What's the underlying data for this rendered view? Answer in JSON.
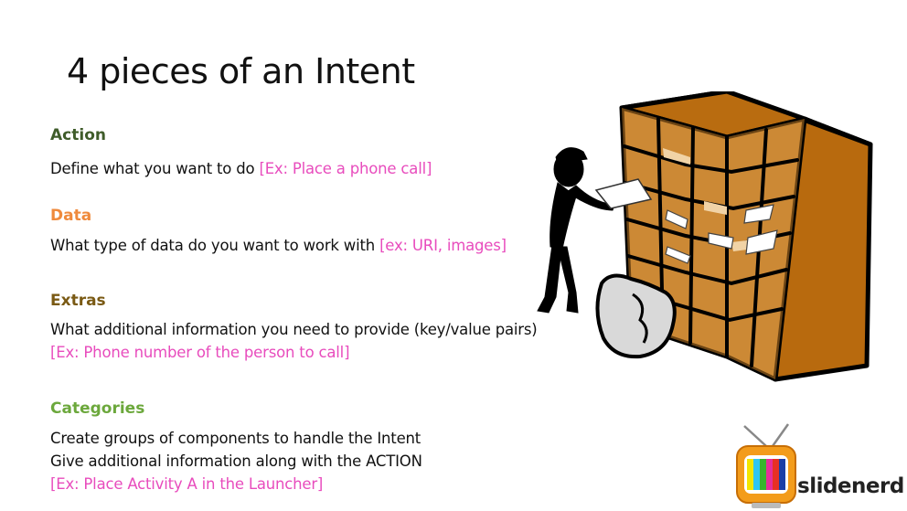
{
  "slide": {
    "title": "4 pieces of an Intent",
    "colors": {
      "action_heading": "#3f5c2a",
      "data_heading": "#ef8a3c",
      "extras_heading": "#7a5a14",
      "categories_heading": "#6ca83c",
      "example_text": "#e84cbd"
    },
    "sections": {
      "action": {
        "heading": "Action",
        "text": "Define what you want to do ",
        "example": "[Ex: Place a phone call]"
      },
      "data": {
        "heading": "Data",
        "text": "What type of data do you want to work with ",
        "example": "[ex: URI, images]"
      },
      "extras": {
        "heading": "Extras",
        "text": "What additional information you need to provide (key/value pairs)",
        "example": "[Ex: Phone number of the person to call]"
      },
      "categories": {
        "heading": "Categories",
        "line1": "Create groups of components to handle the Intent",
        "line2": "Give additional information along with the ACTION",
        "example": "[Ex: Place Activity A in the Launcher]"
      }
    }
  },
  "branding": {
    "logo_text": "slidenerd",
    "logo_icon": "tv-icon"
  },
  "illustration": {
    "icon": "mail-sorting-person-icon"
  }
}
